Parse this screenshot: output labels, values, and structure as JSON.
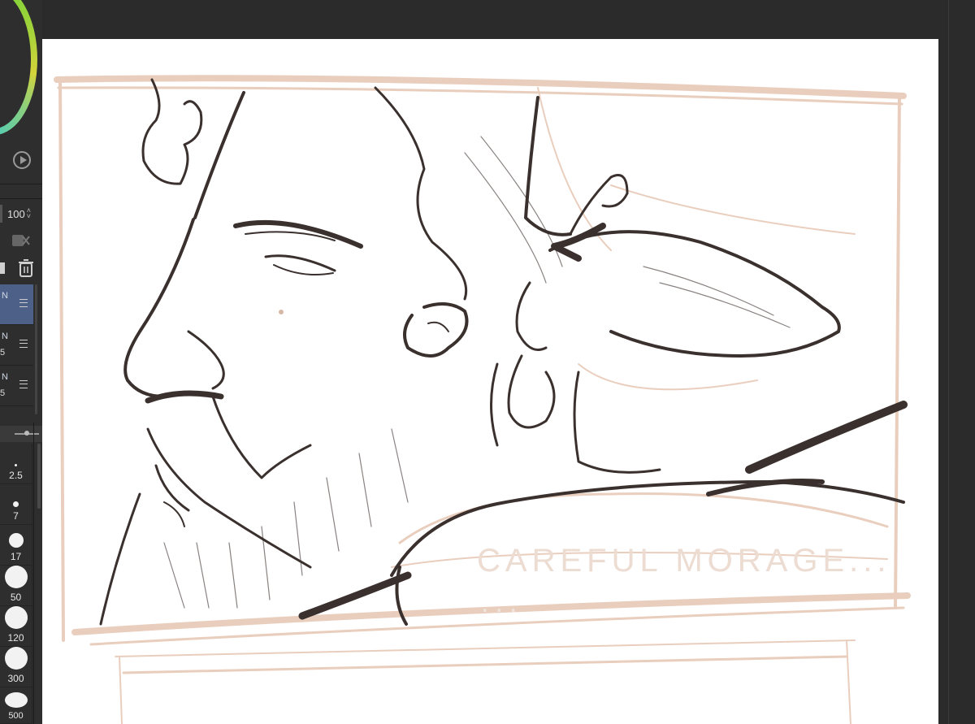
{
  "layers_panel": {
    "opacity_value": "100",
    "layers": [
      {
        "label": "N",
        "num": "",
        "active": true
      },
      {
        "label": "N",
        "num": "5",
        "active": false
      },
      {
        "label": "N",
        "num": "5",
        "active": false
      }
    ]
  },
  "brush_sizes": [
    "",
    "2.5",
    "7",
    "17",
    "50",
    "120",
    "300",
    "500"
  ],
  "canvas": {
    "caption_line1": "CAREFUL MORAGE...",
    "caption_line2": "..."
  },
  "colors": {
    "sketch_line": "#3a302d",
    "rough_sketch": "#e8c9b8",
    "active_layer": "#4d6188",
    "wheel_accent": "#3fd06a"
  }
}
